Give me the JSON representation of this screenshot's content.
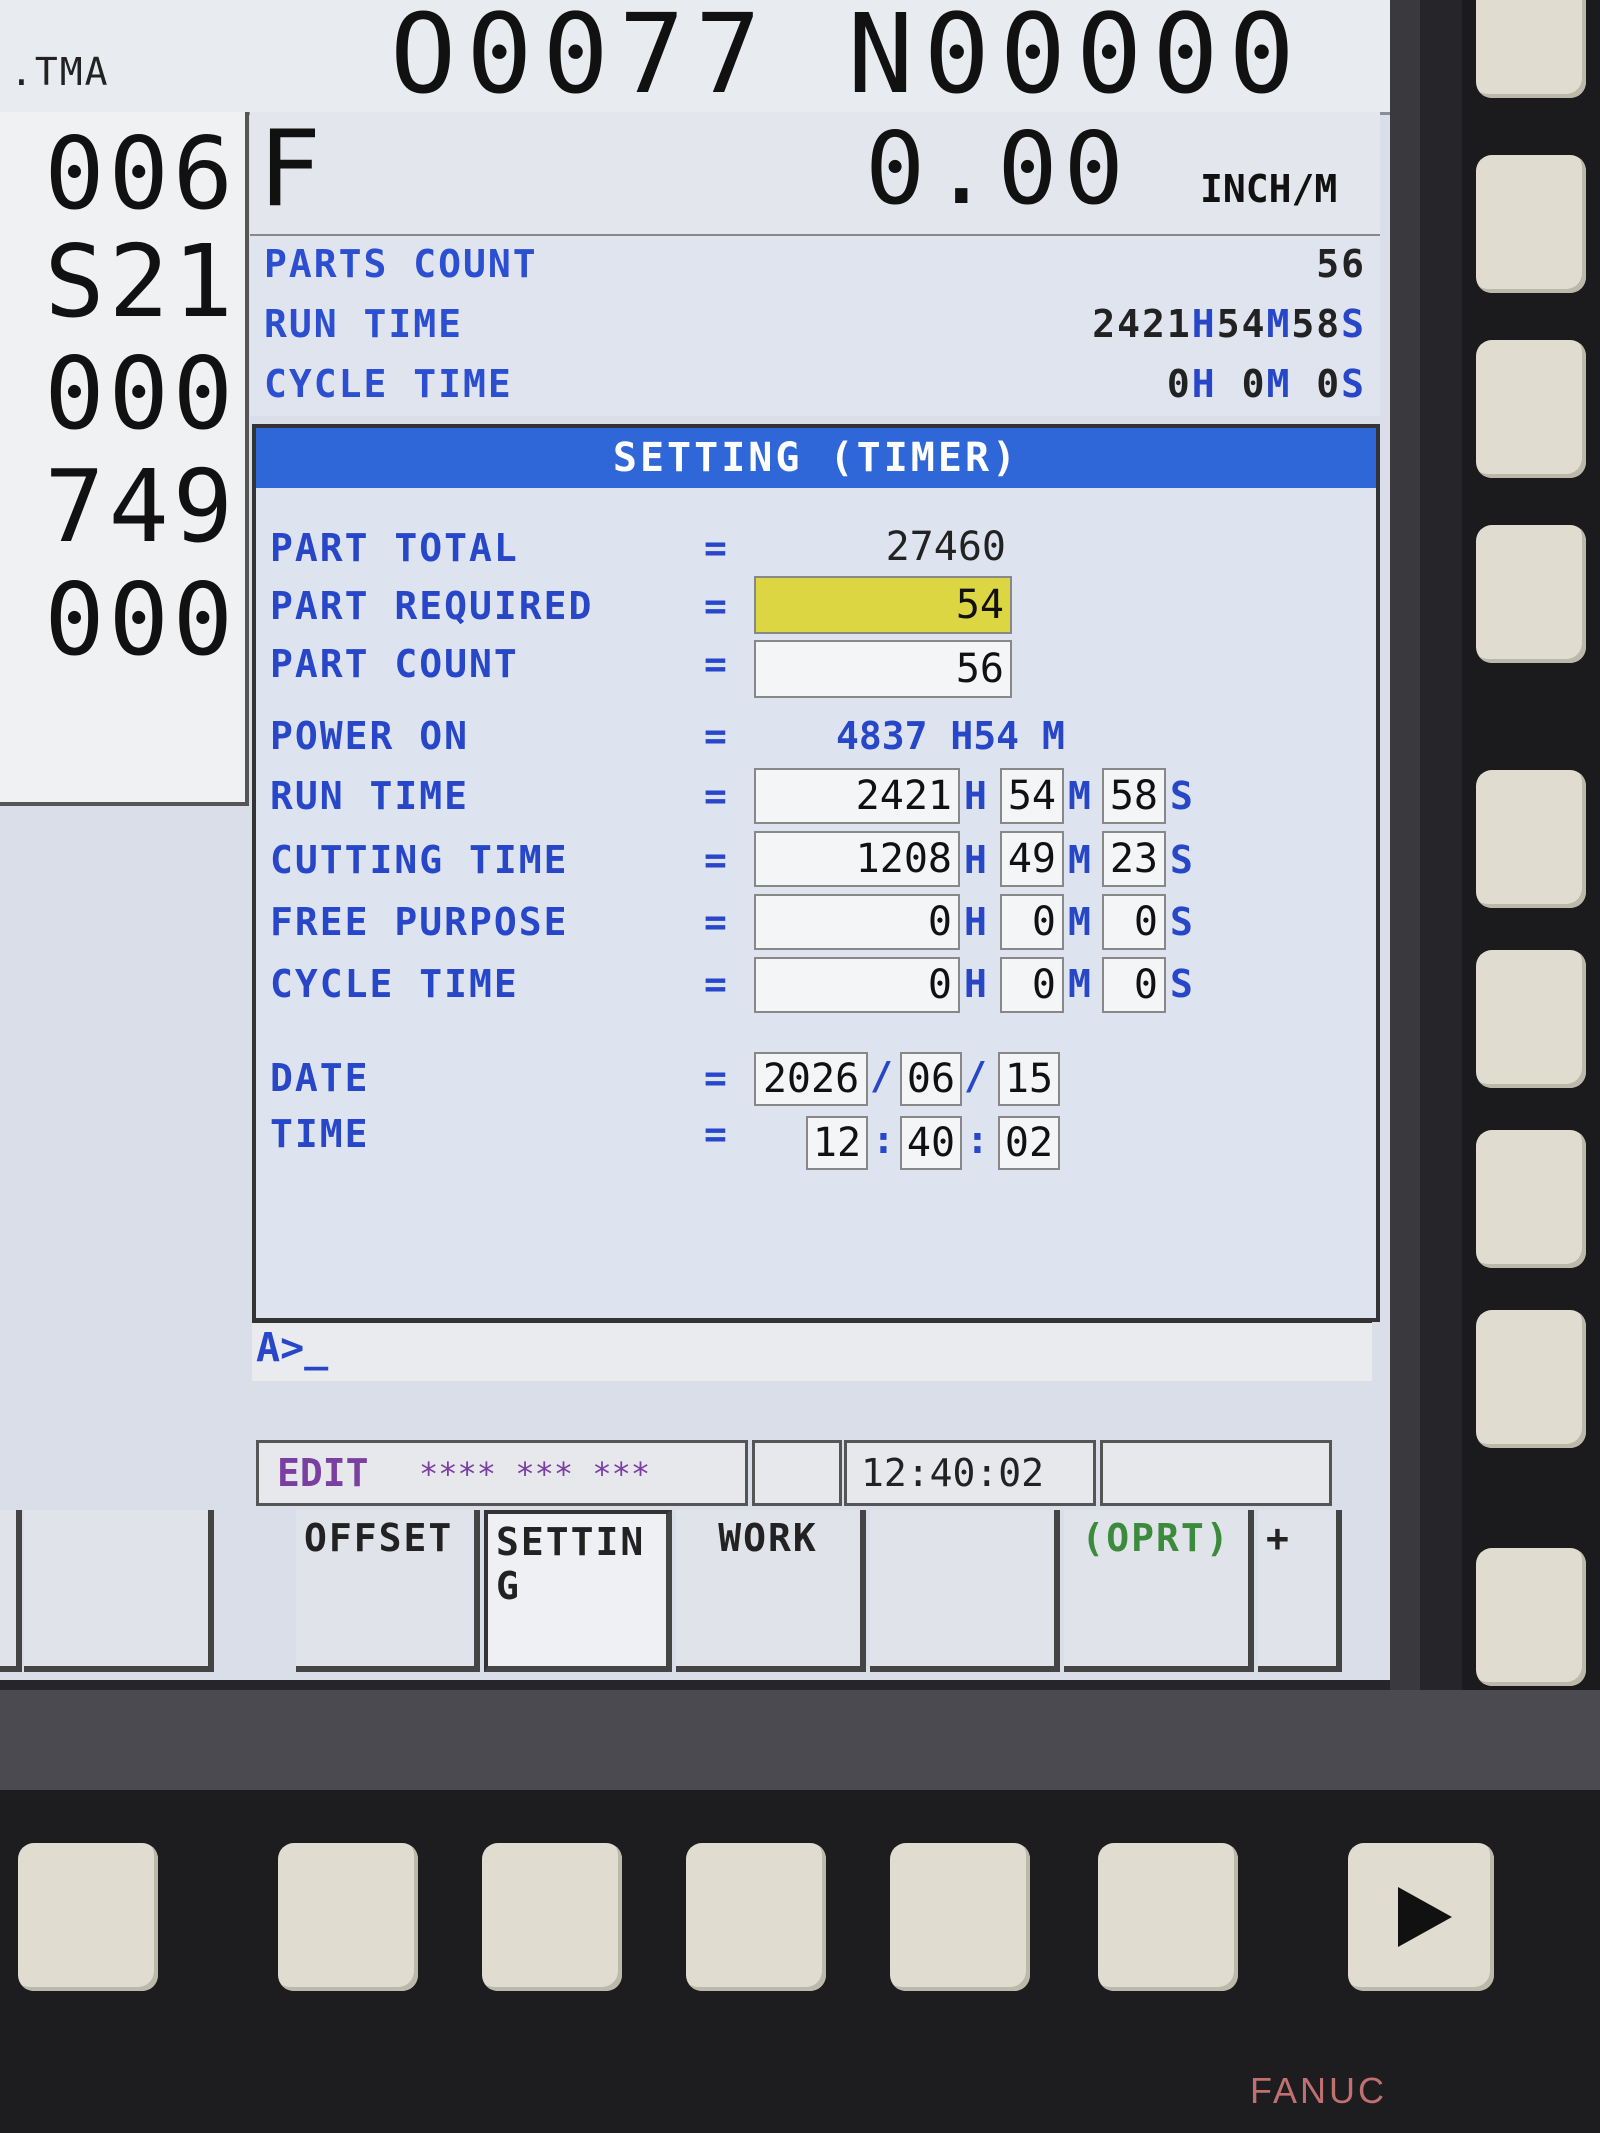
{
  "header": {
    "program_name": ".TMA",
    "program_number": "O0077 N00000"
  },
  "left_panel": {
    "values": [
      "006",
      "S21",
      "000",
      "749",
      "000"
    ]
  },
  "feed": {
    "label": "F",
    "value": "0.00",
    "unit": "INCH/M"
  },
  "counters": {
    "parts_count_label": "PARTS COUNT",
    "parts_count_value": "56",
    "run_time_label": "RUN TIME",
    "run_time_h": "2421",
    "run_time_m": "54",
    "run_time_s": "58",
    "cycle_time_label": "CYCLE TIME",
    "cycle_time_h": "0",
    "cycle_time_m": "0",
    "cycle_time_s": "0"
  },
  "panel": {
    "title": "SETTING (TIMER)",
    "eq": "=",
    "part_total": {
      "label": "PART TOTAL",
      "value": "27460"
    },
    "part_required": {
      "label": "PART REQUIRED",
      "value": "54"
    },
    "part_count": {
      "label": "PART COUNT",
      "value": "56"
    },
    "power_on": {
      "label": "POWER ON",
      "h": "4837",
      "m": "54"
    },
    "run_time": {
      "label": "RUN TIME",
      "h": "2421",
      "m": "54",
      "s": "58"
    },
    "cutting_time": {
      "label": "CUTTING TIME",
      "h": "1208",
      "m": "49",
      "s": "23"
    },
    "free_purpose": {
      "label": "FREE PURPOSE",
      "h": "0",
      "m": "0",
      "s": "0"
    },
    "cycle_time": {
      "label": "CYCLE TIME",
      "h": "0",
      "m": "0",
      "s": "0"
    },
    "date": {
      "label": "DATE",
      "year": "2026",
      "month": "06",
      "day": "15"
    },
    "time": {
      "label": "TIME",
      "hour": "12",
      "minute": "40",
      "second": "02"
    },
    "units": {
      "h": "H",
      "m": "M",
      "s": "S",
      "date_sep": "/",
      "time_sep": ":"
    }
  },
  "command_line": {
    "prompt": "A>_"
  },
  "status": {
    "mode": "EDIT",
    "flags": "**** *** ***",
    "clock": "12:40:02"
  },
  "softkeys": [
    "OFFSET",
    "SETTIN G",
    "WORK",
    "",
    "(OPRT)",
    "+"
  ],
  "brand": "FANUC",
  "colors": {
    "label_blue": "#2747c8",
    "title_bar": "#2f66d8",
    "highlight_yellow": "#dcd642",
    "mode_purple": "#7a3fa0",
    "oprt_green": "#3c8a3c"
  }
}
